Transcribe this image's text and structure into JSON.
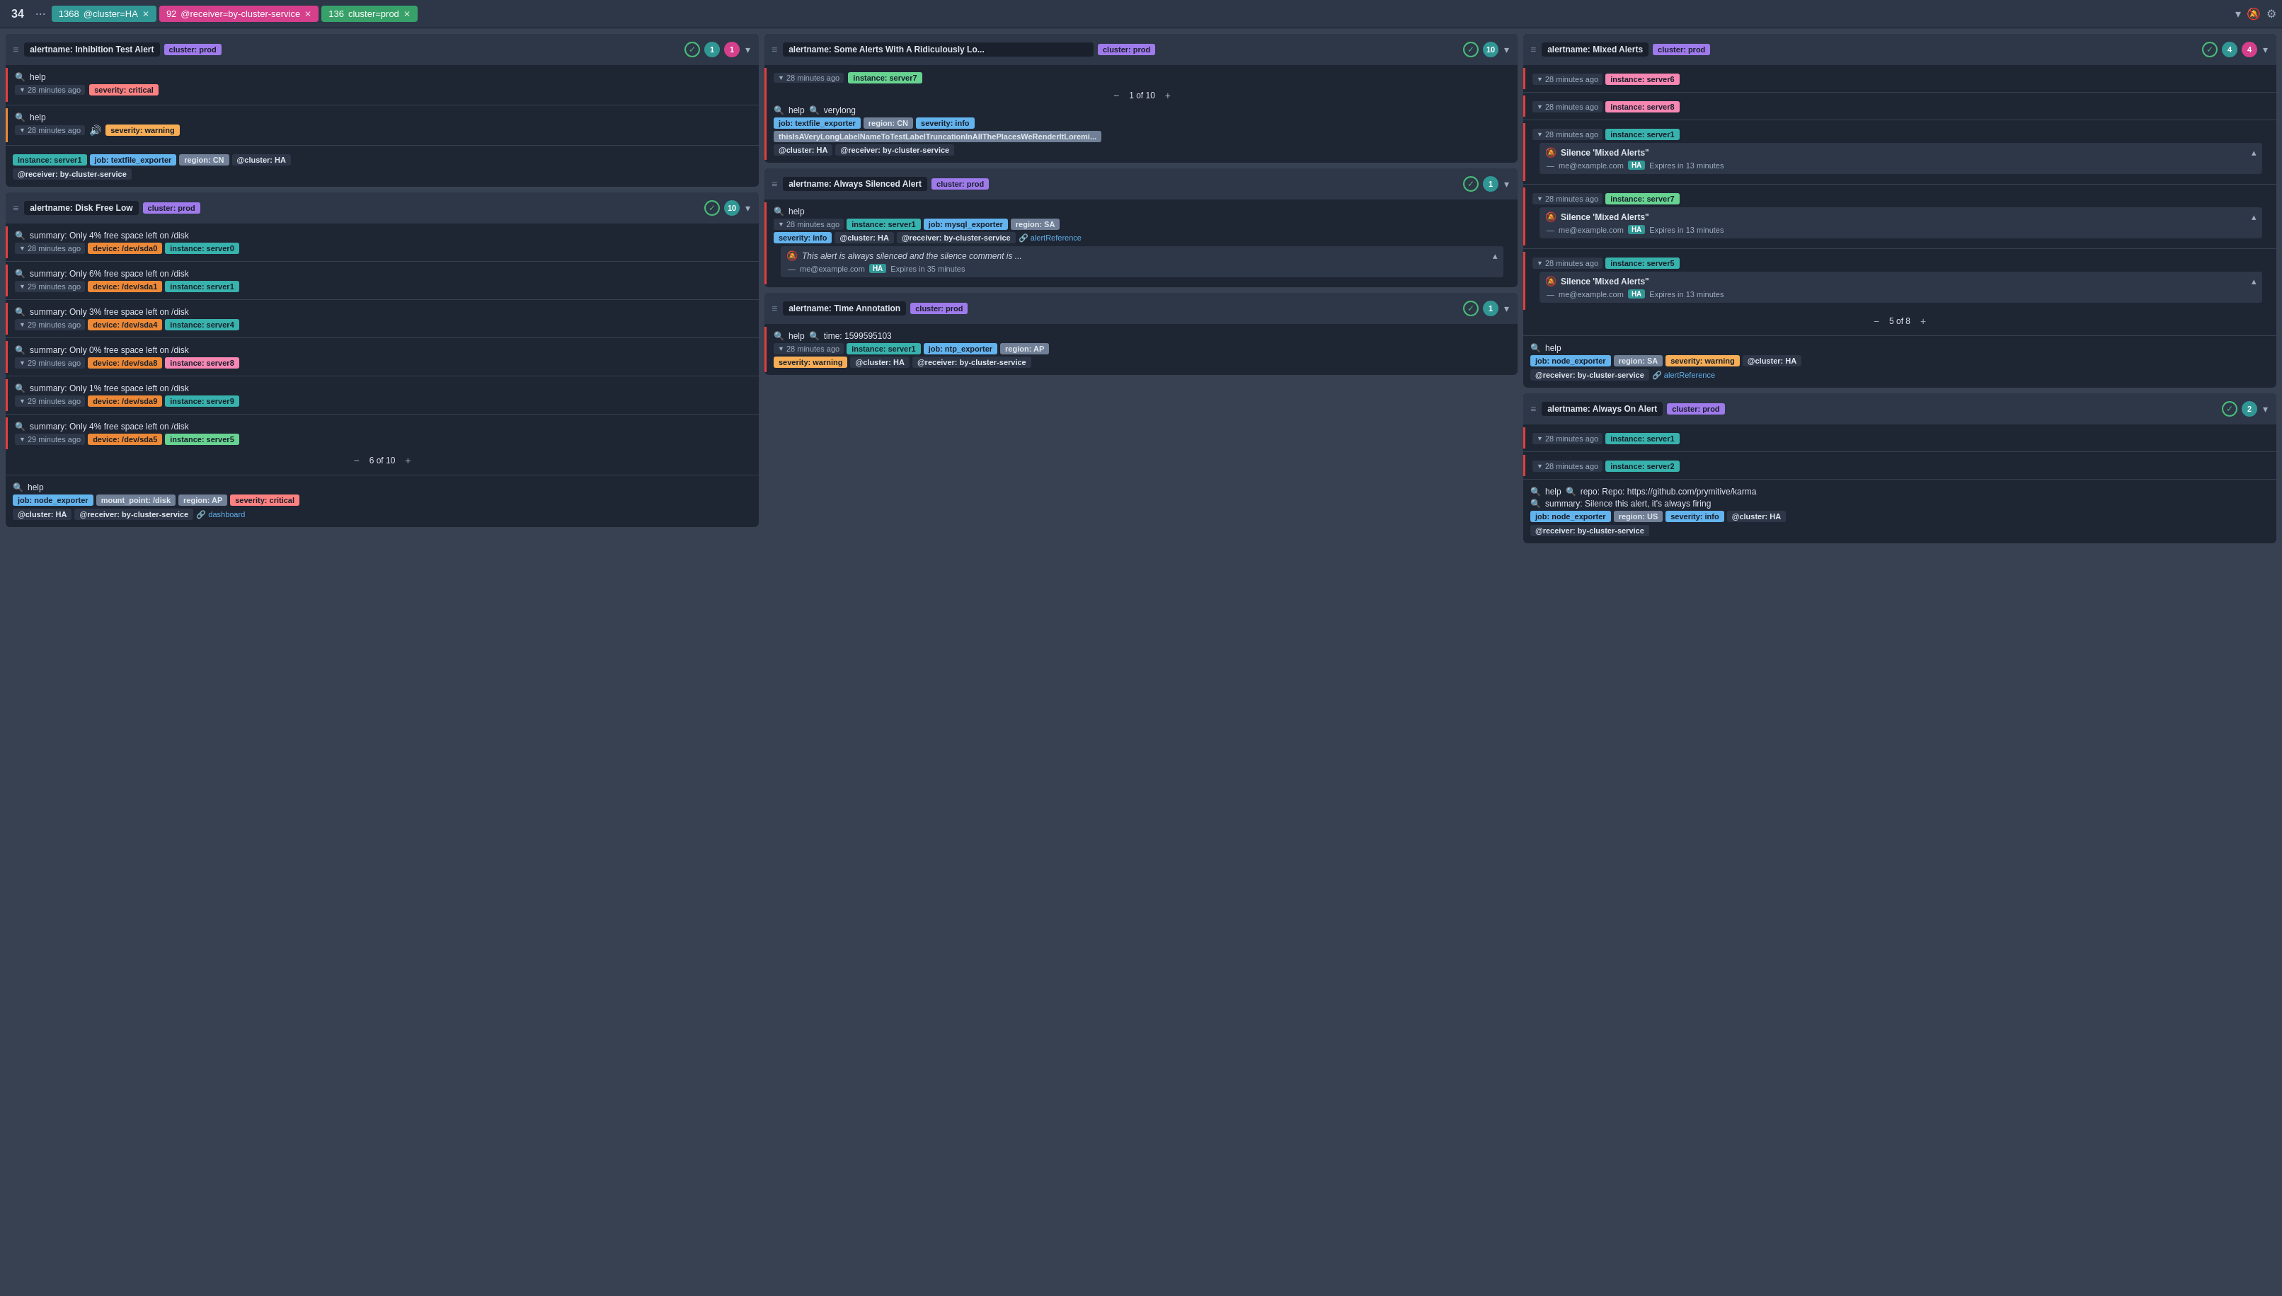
{
  "topbar": {
    "total_count": "34",
    "dots": "···",
    "tabs": [
      {
        "id": "tab1",
        "number": "1368",
        "label": "@cluster=HA",
        "color": "teal"
      },
      {
        "id": "tab2",
        "number": "92",
        "label": "@receiver=by-cluster-service",
        "color": "pink"
      },
      {
        "id": "tab3",
        "number": "136",
        "label": "cluster=prod",
        "color": "green"
      }
    ]
  },
  "groups": [
    {
      "id": "group1",
      "name": "alertname: Inhibition Test Alert",
      "labels": [
        {
          "text": "cluster: prod",
          "color": "prod"
        }
      ],
      "check": true,
      "count1": "1",
      "count1_color": "teal",
      "count2": "1",
      "count2_color": "pink",
      "alerts": [
        {
          "search": true,
          "text": "help",
          "time": "28 minutes ago",
          "labels": [
            {
              "text": "severity: critical",
              "color": "critical"
            }
          ],
          "border": "active"
        },
        {
          "search": true,
          "text": "help",
          "time": "28 minutes ago",
          "sound": true,
          "labels": [
            {
              "text": "severity: warning",
              "color": "warning"
            }
          ],
          "border": "warning"
        }
      ],
      "footer_labels": [
        {
          "text": "instance: server1",
          "color": "teal"
        },
        {
          "text": "job: textfile_exporter",
          "color": "blue"
        },
        {
          "text": "region: CN",
          "color": "gray"
        },
        {
          "text": "@cluster: HA",
          "color": "dark"
        }
      ],
      "footer_labels2": [
        {
          "text": "@receiver: by-cluster-service",
          "color": "dark"
        }
      ]
    },
    {
      "id": "group2",
      "name": "alertname: Disk Free Low",
      "labels": [
        {
          "text": "cluster: prod",
          "color": "prod"
        }
      ],
      "check": true,
      "count1": "10",
      "count1_color": "teal",
      "alerts": [
        {
          "text": "summary: Only 4% free space left on /disk",
          "time": "28 minutes ago",
          "labels": [
            {
              "text": "device: /dev/sda0",
              "color": "orange"
            },
            {
              "text": "instance: server0",
              "color": "teal"
            }
          ],
          "border": "active"
        },
        {
          "text": "summary: Only 6% free space left on /disk",
          "time": "29 minutes ago",
          "labels": [
            {
              "text": "device: /dev/sda1",
              "color": "orange"
            },
            {
              "text": "instance: server1",
              "color": "teal"
            }
          ],
          "border": "active"
        },
        {
          "text": "summary: Only 3% free space left on /disk",
          "time": "29 minutes ago",
          "labels": [
            {
              "text": "device: /dev/sda4",
              "color": "orange"
            },
            {
              "text": "instance: server4",
              "color": "teal"
            }
          ],
          "border": "active"
        },
        {
          "text": "summary: Only 0% free space left on /disk",
          "time": "29 minutes ago",
          "labels": [
            {
              "text": "device: /dev/sda8",
              "color": "orange"
            },
            {
              "text": "instance: server8",
              "color": "pink"
            }
          ],
          "border": "active"
        },
        {
          "text": "summary: Only 1% free space left on /disk",
          "time": "29 minutes ago",
          "labels": [
            {
              "text": "device: /dev/sda9",
              "color": "orange"
            },
            {
              "text": "instance: server9",
              "color": "teal"
            }
          ],
          "border": "active"
        },
        {
          "text": "summary: Only 4% free space left on /disk",
          "time": "29 minutes ago",
          "labels": [
            {
              "text": "device: /dev/sda5",
              "color": "orange"
            },
            {
              "text": "instance: server5",
              "color": "green"
            }
          ],
          "border": "active"
        }
      ],
      "pagination": {
        "current": "6",
        "total": "10"
      },
      "footer_search": true,
      "footer_text": "help",
      "footer_labels": [
        {
          "text": "job: node_exporter",
          "color": "blue"
        },
        {
          "text": "mount_point: /disk",
          "color": "gray"
        },
        {
          "text": "region: AP",
          "color": "gray"
        },
        {
          "text": "severity: critical",
          "color": "critical"
        }
      ],
      "footer_labels2": [
        {
          "text": "@cluster: HA",
          "color": "dark"
        },
        {
          "text": "@receiver: by-cluster-service",
          "color": "dark"
        }
      ],
      "footer_link": "dashboard"
    },
    {
      "id": "group3",
      "name": "alertname: Some Alerts With A Ridiculously Lo...",
      "labels": [
        {
          "text": "cluster: prod",
          "color": "prod"
        }
      ],
      "check": true,
      "count1": "10",
      "count1_color": "teal",
      "alerts": [
        {
          "time": "28 minutes ago",
          "labels_top": [
            {
              "text": "instance: server7",
              "color": "green"
            }
          ],
          "border": "active",
          "pagination_inline": {
            "current": "1",
            "total": "10"
          },
          "search": true,
          "text": "help",
          "search2": true,
          "text2": "verylong",
          "label_rows": [
            [
              {
                "text": "job: textfile_exporter",
                "color": "blue"
              },
              {
                "text": "region: CN",
                "color": "gray"
              },
              {
                "text": "severity: info",
                "color": "info"
              }
            ],
            [
              {
                "text": "thisIsAVeryLongLabelNameToTestLabelTruncationInAllThePlacesWeRenderItLoremi...",
                "color": "gray",
                "long": true
              }
            ],
            [
              {
                "text": "@cluster: HA",
                "color": "dark"
              },
              {
                "text": "@receiver: by-cluster-service",
                "color": "dark"
              }
            ]
          ]
        }
      ]
    },
    {
      "id": "group4",
      "name": "alertname: Always Silenced Alert",
      "labels": [
        {
          "text": "cluster: prod",
          "color": "prod"
        }
      ],
      "check": true,
      "count1": "1",
      "count1_color": "teal",
      "alerts": [
        {
          "search": true,
          "text": "help",
          "time": "28 minutes ago",
          "labels": [
            {
              "text": "instance: server1",
              "color": "teal"
            },
            {
              "text": "job: mysql_exporter",
              "color": "blue"
            },
            {
              "text": "region: SA",
              "color": "gray"
            }
          ],
          "labels2": [
            {
              "text": "severity: info",
              "color": "info"
            },
            {
              "text": "@cluster: HA",
              "color": "dark"
            },
            {
              "text": "@receiver: by-cluster-service",
              "color": "dark"
            }
          ],
          "ref_link": "alertReference",
          "silence": {
            "icon": "🔕",
            "title": "This alert is always silenced and the silence comment is ...",
            "user": "me@example.com",
            "user_badge": "HA",
            "expires": "Expires in 35 minutes"
          },
          "border": "active"
        }
      ]
    },
    {
      "id": "group5",
      "name": "alertname: Time Annotation",
      "labels": [
        {
          "text": "cluster: prod",
          "color": "prod"
        }
      ],
      "check": true,
      "count1": "1",
      "count1_color": "teal",
      "alerts": [
        {
          "search": true,
          "text": "help",
          "search2": true,
          "text2": "time: 1599595103",
          "time": "28 minutes ago",
          "labels": [
            {
              "text": "instance: server1",
              "color": "teal"
            },
            {
              "text": "job: ntp_exporter",
              "color": "blue"
            },
            {
              "text": "region: AP",
              "color": "gray"
            }
          ],
          "labels2": [
            {
              "text": "severity: warning",
              "color": "warning"
            },
            {
              "text": "@cluster: HA",
              "color": "dark"
            },
            {
              "text": "@receiver: by-cluster-service",
              "color": "dark"
            }
          ],
          "border": "active"
        }
      ]
    },
    {
      "id": "group6",
      "name": "alertname: Mixed Alerts",
      "labels": [
        {
          "text": "cluster: prod",
          "color": "prod"
        }
      ],
      "check": true,
      "count1": "4",
      "count1_color": "teal",
      "count2": "4",
      "count2_color": "pink",
      "alerts": [
        {
          "time": "28 minutes ago",
          "labels": [
            {
              "text": "instance: server6",
              "color": "pink"
            }
          ],
          "border": "active"
        },
        {
          "time": "28 minutes ago",
          "labels": [
            {
              "text": "instance: server8",
              "color": "pink"
            }
          ],
          "border": "active"
        },
        {
          "time": "28 minutes ago",
          "labels": [
            {
              "text": "instance: server1",
              "color": "teal"
            }
          ],
          "border": "active",
          "silences": [
            {
              "icon": "🔕",
              "title": "Silence 'Mixed Alerts\"",
              "user": "me@example.com",
              "user_badge": "HA",
              "expires": "Expires in 13 minutes",
              "expanded": true
            }
          ]
        },
        {
          "time": "28 minutes ago",
          "labels": [
            {
              "text": "instance: server7",
              "color": "green"
            }
          ],
          "border": "active",
          "silences": [
            {
              "icon": "🔕",
              "title": "Silence 'Mixed Alerts\"",
              "user": "me@example.com",
              "user_badge": "HA",
              "expires": "Expires in 13 minutes",
              "expanded": true
            }
          ]
        },
        {
          "time": "28 minutes ago",
          "labels": [
            {
              "text": "instance: server5",
              "color": "teal"
            }
          ],
          "border": "active",
          "silences": [
            {
              "icon": "🔕",
              "title": "Silence 'Mixed Alerts\"",
              "user": "me@example.com",
              "user_badge": "HA",
              "expires": "Expires in 13 minutes",
              "expanded": true
            }
          ]
        }
      ],
      "pagination": {
        "current": "5",
        "total": "8"
      },
      "footer_search": true,
      "footer_text": "help",
      "footer_labels": [
        {
          "text": "job: node_exporter",
          "color": "blue"
        },
        {
          "text": "region: SA",
          "color": "gray"
        },
        {
          "text": "severity: warning",
          "color": "warning"
        },
        {
          "text": "@cluster: HA",
          "color": "dark"
        }
      ],
      "footer_labels2": [
        {
          "text": "@receiver: by-cluster-service",
          "color": "dark"
        }
      ],
      "footer_ref_link": "alertReference"
    },
    {
      "id": "group7",
      "name": "alertname: Always On Alert",
      "labels": [
        {
          "text": "cluster: prod",
          "color": "prod"
        }
      ],
      "check": true,
      "count1": "2",
      "count1_color": "teal",
      "alerts": [
        {
          "time": "28 minutes ago",
          "labels": [
            {
              "text": "instance: server1",
              "color": "teal"
            }
          ],
          "border": "active"
        },
        {
          "time": "28 minutes ago",
          "labels": [
            {
              "text": "instance: server2",
              "color": "teal"
            }
          ],
          "border": "active"
        }
      ],
      "footer_search": true,
      "footer_text": "help",
      "footer_search2": true,
      "footer_text2": "repo: Repo: https://github.com/prymitive/karma",
      "footer_search3": true,
      "footer_text3": "summary: Silence this alert, it's always firing",
      "footer_labels": [
        {
          "text": "job: node_exporter",
          "color": "blue"
        },
        {
          "text": "region: US",
          "color": "gray"
        },
        {
          "text": "severity: info",
          "color": "info"
        },
        {
          "text": "@cluster: HA",
          "color": "dark"
        }
      ],
      "footer_labels2": [
        {
          "text": "@receiver: by-cluster-service",
          "color": "dark"
        }
      ]
    }
  ],
  "icons": {
    "drag": "≡",
    "check": "✓",
    "chevron_down": "▾",
    "chevron_up": "▴",
    "search": "🔍",
    "sound": "🔊",
    "silence": "🔕",
    "link": "🔗",
    "minus": "−",
    "plus": "+"
  }
}
